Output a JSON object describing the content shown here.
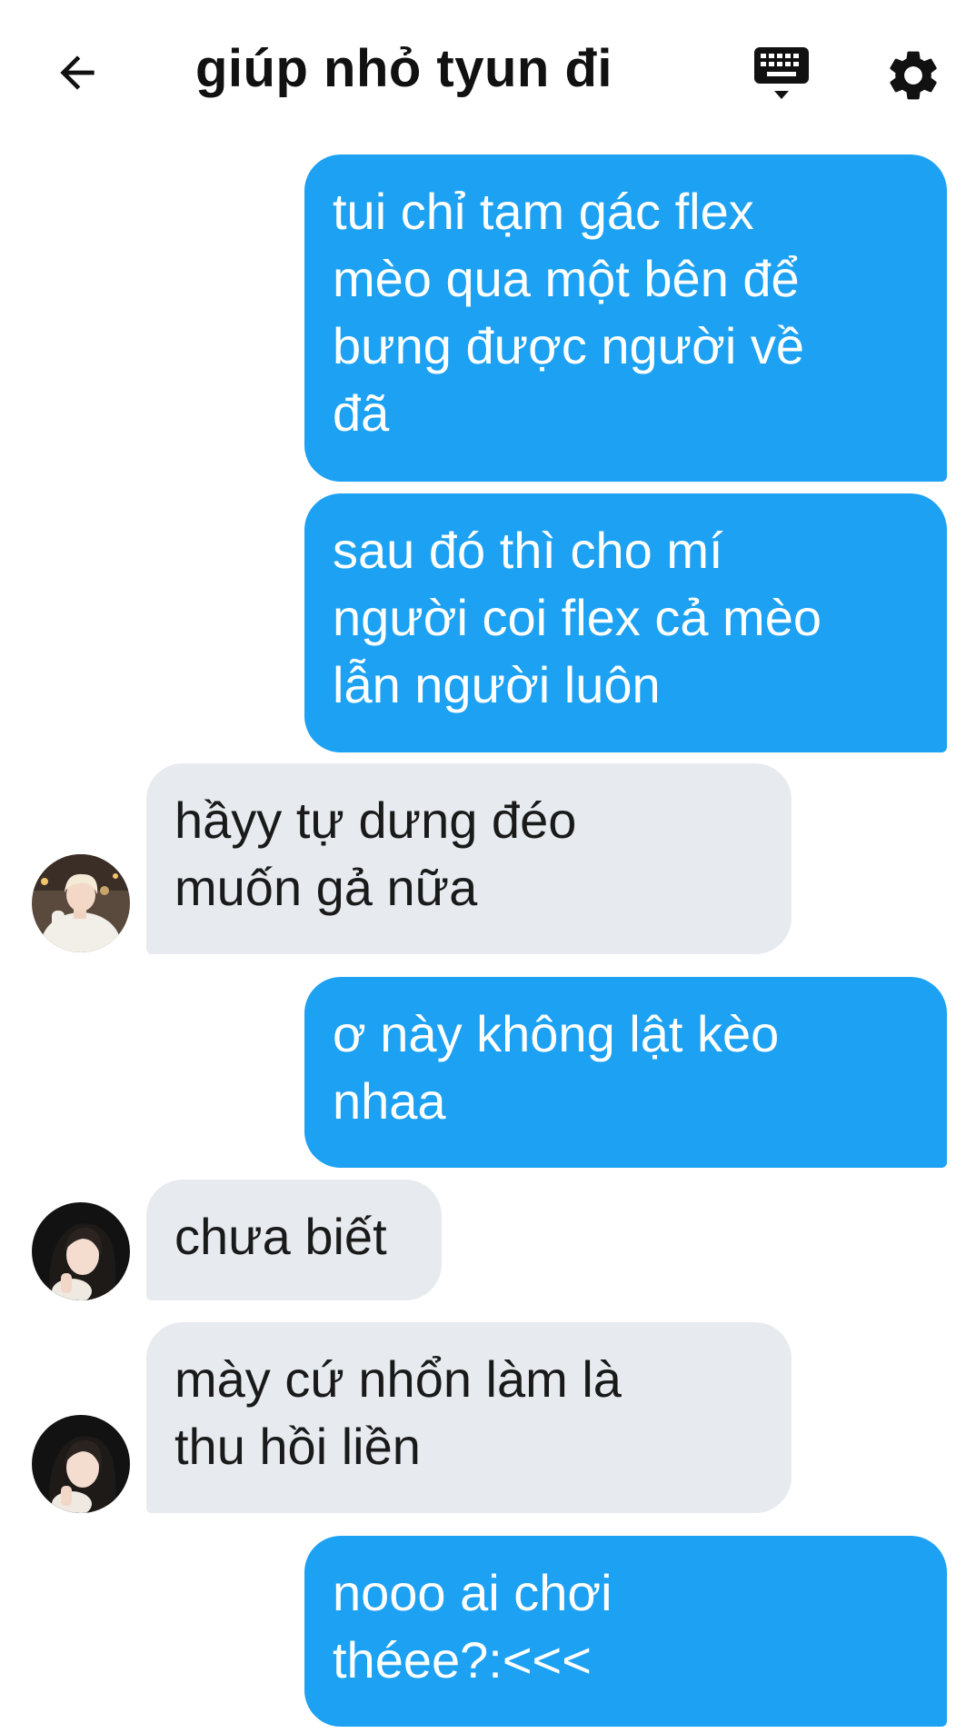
{
  "header": {
    "title": "giúp nhỏ tyun đi",
    "back_icon": "arrow-left-icon",
    "keyboard_icon": "keyboard-icon",
    "settings_icon": "gear-icon"
  },
  "colors": {
    "outgoing_bubble": "#1da1f2",
    "incoming_bubble": "#e7ebef",
    "outgoing_text": "#ffffff",
    "incoming_text": "#1a1a1a"
  },
  "messages": [
    {
      "sender": "me",
      "text": "tui chỉ tạm gác flex\nmèo qua một bên để\nbưng được người về\nđã"
    },
    {
      "sender": "me",
      "text": "sau đó thì cho mí\nngười coi flex cả mèo\nlẫn người luôn"
    },
    {
      "sender": "them",
      "avatar": "avatar-blonde",
      "text": "hầyy tự dưng đéo\nmuốn gả nữa"
    },
    {
      "sender": "me",
      "text": "ơ này không lật kèo\nnhaa"
    },
    {
      "sender": "them",
      "avatar": "avatar-darkhair",
      "text": "chưa biết"
    },
    {
      "sender": "them",
      "avatar": "avatar-darkhair",
      "text": "mày cứ nhổn làm là\nthu hồi liền"
    },
    {
      "sender": "me",
      "text": "nooo ai chơi\nthéee?:<<<"
    }
  ]
}
